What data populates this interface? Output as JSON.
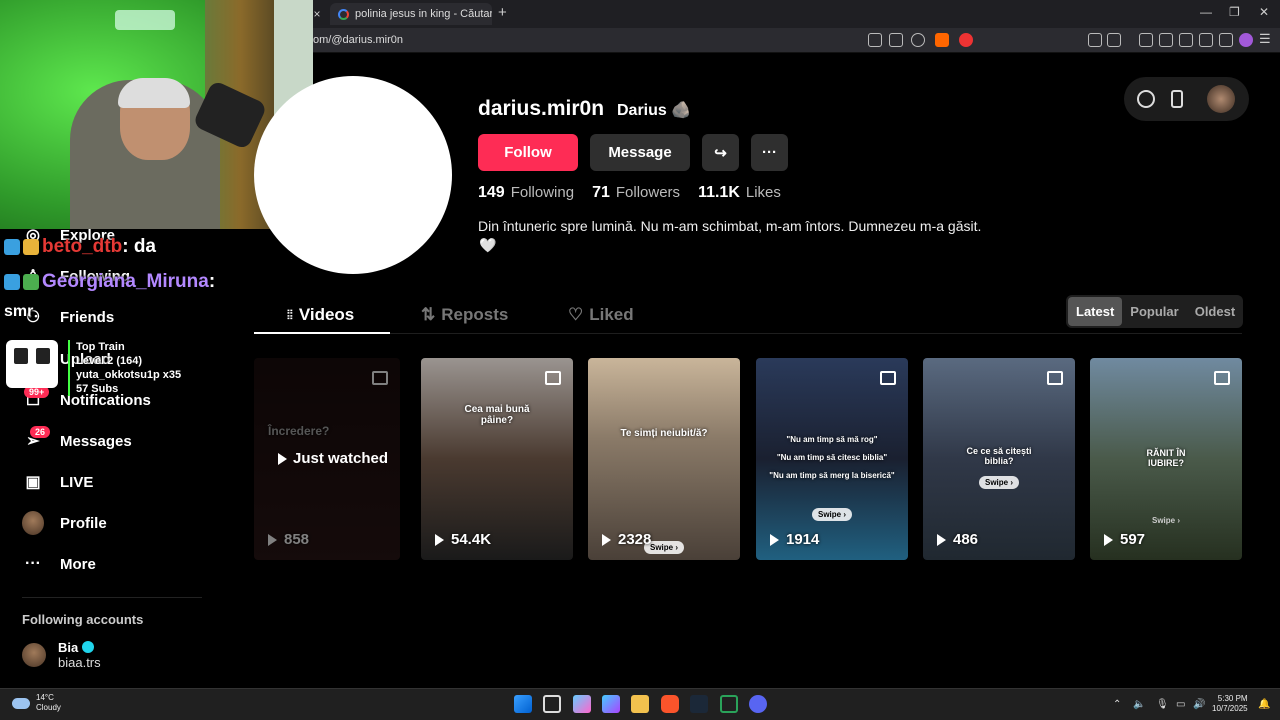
{
  "browser": {
    "tab_title": "polinia jesus in king - Căutare Google",
    "url": "om/@darius.mir0n",
    "new_tab": "+",
    "close": "×"
  },
  "sidebar": {
    "items": [
      {
        "label": "Explore",
        "icon": "compass-icon"
      },
      {
        "label": "Following",
        "icon": "user-icon"
      },
      {
        "label": "Friends",
        "icon": "friends-icon"
      },
      {
        "label": "Upload",
        "icon": "upload-icon"
      },
      {
        "label": "Notifications",
        "icon": "inbox-icon",
        "badge": "99+"
      },
      {
        "label": "Messages",
        "icon": "paper-plane-icon",
        "badge": "26"
      },
      {
        "label": "LIVE",
        "icon": "live-tv-icon"
      },
      {
        "label": "Profile",
        "icon": "avatar"
      },
      {
        "label": "More",
        "icon": "more-icon"
      }
    ],
    "following_title": "Following accounts",
    "account": {
      "name": "Bia",
      "handle": "biaa.trs"
    }
  },
  "chat": {
    "line1_user": "beto_dtb",
    "line1_msg": " : da",
    "line2_user": "Georgiana_Miruna",
    "line2_msg": " :",
    "line3_user": "smr",
    "train_title": "Top Train",
    "train_level": "Level 2 (164)",
    "train_user": "yuta_okkotsu1p x35",
    "train_subs": "57 Subs"
  },
  "profile": {
    "username": "darius.mir0n",
    "nickname": "Darius",
    "follow_label": "Follow",
    "message_label": "Message",
    "following_count": "149",
    "following_label": "Following",
    "followers_count": "71",
    "followers_label": "Followers",
    "likes_count": "11.1K",
    "likes_label": "Likes",
    "bio": "Din întuneric spre lumină. Nu m-am schimbat, m-am întors. Dumnezeu m-a găsit.",
    "bio_heart": "🤍"
  },
  "tabs": {
    "videos": "Videos",
    "reposts": "Reposts",
    "liked": "Liked"
  },
  "sort": {
    "latest": "Latest",
    "popular": "Popular",
    "oldest": "Oldest"
  },
  "videos": [
    {
      "views": "858",
      "caption": "Încredere?",
      "overlay": "Just watched"
    },
    {
      "views": "54.4K",
      "caption": "Cea mai bună pâine?"
    },
    {
      "views": "2328",
      "caption": "Te simți neiubit/ă?",
      "swipe": "Swipe ›"
    },
    {
      "views": "1914",
      "caption1": "\"Nu am timp să mă rog\"",
      "caption2": "\"Nu am timp să citesc biblia\"",
      "caption3": "\"Nu am timp să merg la biserică\"",
      "swipe": "Swipe ›"
    },
    {
      "views": "486",
      "caption": "Ce ce să citești biblia?",
      "swipe": "Swipe ›"
    },
    {
      "views": "597",
      "caption": "RĂNIT ÎN IUBIRE?",
      "swipe": "Swipe ›"
    }
  ],
  "taskbar": {
    "temp": "14°C",
    "weather": "Cloudy",
    "time": "5:30 PM",
    "date": "10/7/2025"
  }
}
